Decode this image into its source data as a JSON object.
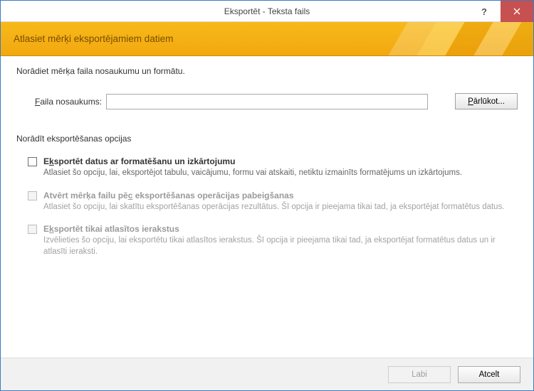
{
  "titlebar": {
    "title": "Eksportēt - Teksta fails",
    "help_symbol": "?"
  },
  "banner": {
    "text": "Atlasiet mērķi eksportējamiem datiem"
  },
  "instructions": "Norādiet mērķa faila nosaukumu un formātu.",
  "file": {
    "label_pre": "F",
    "label_post": "aila nosaukums:",
    "value": "",
    "browse_pre": "P",
    "browse_post": "ārlūkot..."
  },
  "options_heading": "Norādīt eksportēšanas opcijas",
  "options": [
    {
      "enabled": true,
      "title_pre": "E",
      "title_accel": "k",
      "title_post": "sportēt datus ar formatēšanu un izkārtojumu",
      "desc": "Atlasiet šo opciju, lai, eksportējot tabulu, vaicājumu, formu vai atskaiti, netiktu izmainīts formatējums un izkārtojums."
    },
    {
      "enabled": false,
      "title_pre": "Atvērt mērķa failu pē",
      "title_accel": "c",
      "title_post": " eksportēšanas operācijas pabeigšanas",
      "desc": "Atlasiet šo opciju, lai skatītu eksportēšanas operācijas rezultātus. Šī opcija ir pieejama tikai tad, ja eksportējat formatētus datus."
    },
    {
      "enabled": false,
      "title_pre": "E",
      "title_accel": "k",
      "title_post": "sportēt tikai atlasītos ierakstus",
      "desc": "Izvēlieties šo opciju, lai eksportētu tikai atlasītos ierakstus. Šī opcija ir pieejama tikai tad, ja eksportējat formatētus datus un ir atlasīti ieraksti."
    }
  ],
  "footer": {
    "ok": "Labi",
    "cancel": "Atcelt"
  }
}
